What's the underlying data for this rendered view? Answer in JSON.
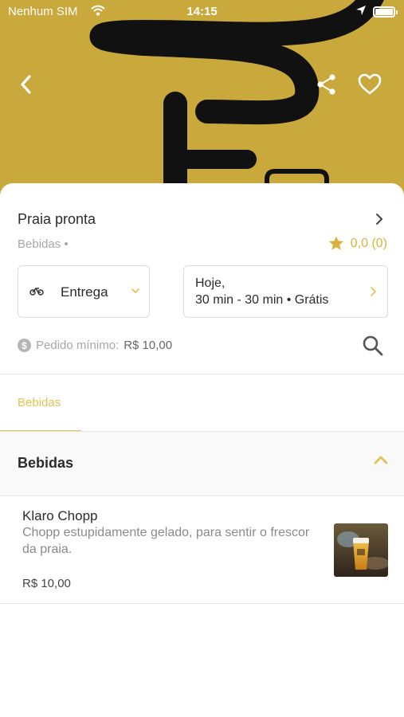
{
  "status_bar": {
    "carrier": "Nenhum SIM",
    "time": "14:15"
  },
  "header": {
    "back_icon": "chevron-left-icon",
    "share_icon": "share-icon",
    "favorite_icon": "heart-outline-icon",
    "background_color": "#c9a83c"
  },
  "store": {
    "name": "Praia pronta",
    "category": "Bebidas •",
    "rating": "0,0 (0)"
  },
  "delivery": {
    "mode": "Entrega",
    "schedule_line1": "Hoje,",
    "schedule_line2": "30 min - 30 min • Grátis"
  },
  "min_order": {
    "label": "Pedido mínimo:",
    "value": "R$ 10,00"
  },
  "tabs": [
    {
      "label": "Bebidas",
      "active": true
    }
  ],
  "section": {
    "title": "Bebidas"
  },
  "products": [
    {
      "name": "Klaro Chopp",
      "description": "Chopp estupidamente gelado, para sentir o frescor da praia.",
      "price": "R$ 10,00"
    }
  ],
  "colors": {
    "accent": "#e4c152",
    "star": "#d9b23c",
    "muted_text": "#a7a7a7"
  }
}
